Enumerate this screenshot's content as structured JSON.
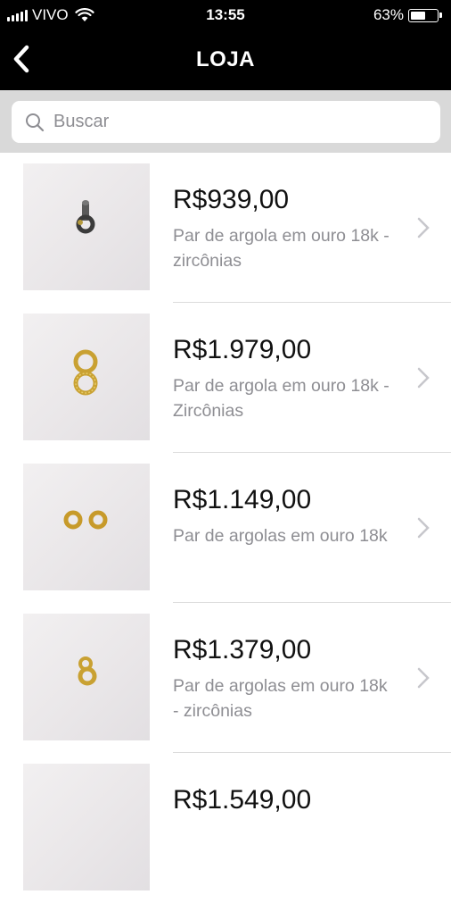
{
  "status_bar": {
    "carrier": "VIVO",
    "time": "13:55",
    "battery_percent": "63%",
    "battery_level": 0.63
  },
  "nav": {
    "title": "LOJA",
    "back_icon": "chevron-left-icon"
  },
  "search": {
    "placeholder": "Buscar",
    "value": "",
    "icon": "search-icon"
  },
  "products": [
    {
      "price": "R$939,00",
      "description": "Par de argola em ouro 18k - zircônias"
    },
    {
      "price": "R$1.979,00",
      "description": "Par de argola em ouro 18k - Zircônias"
    },
    {
      "price": "R$1.149,00",
      "description": "Par de argolas em ouro 18k"
    },
    {
      "price": "R$1.379,00",
      "description": "Par de argolas em ouro 18k - zircônias"
    },
    {
      "price": "R$1.549,00",
      "description": ""
    }
  ],
  "colors": {
    "header_bg": "#000000",
    "search_bg": "#d9d9d9",
    "secondary_text": "#8e8e93",
    "chevron": "#c7c7cc"
  }
}
